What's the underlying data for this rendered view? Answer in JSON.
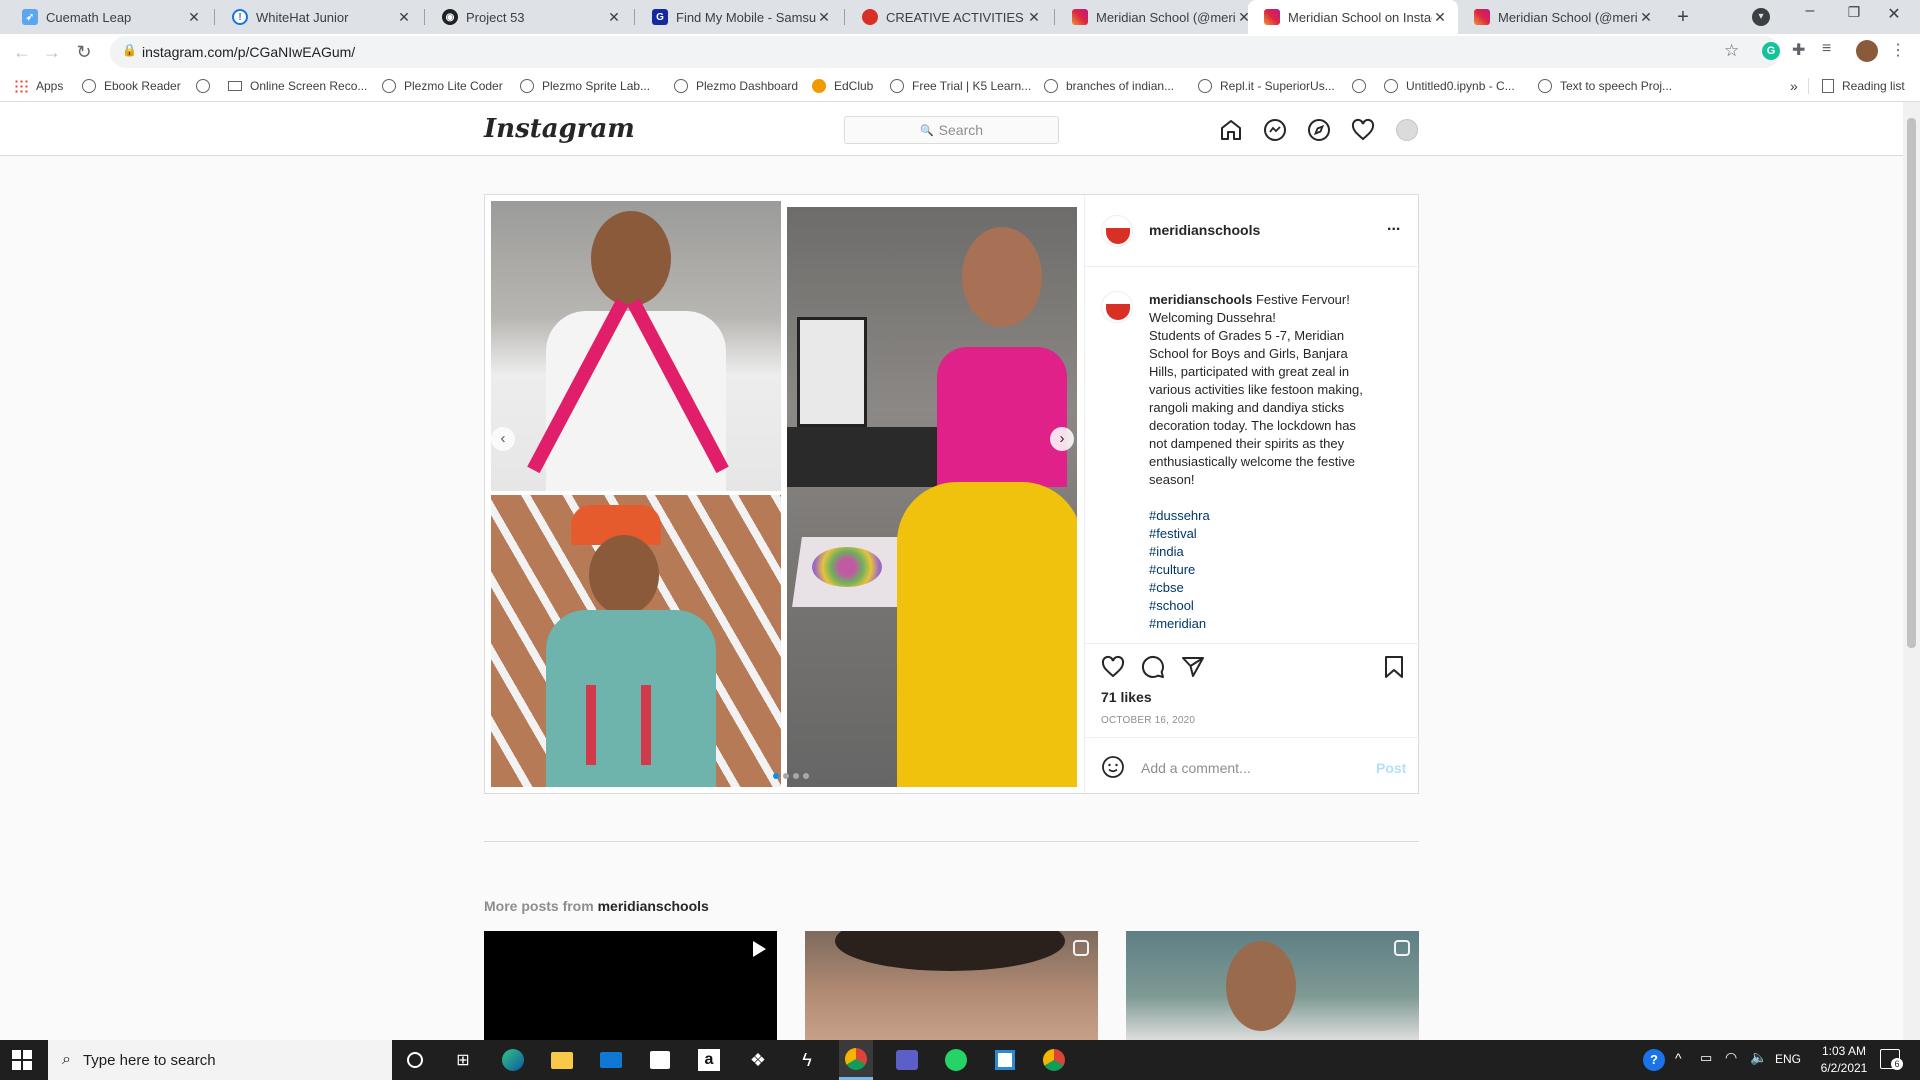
{
  "browser": {
    "tabs": [
      {
        "label": "Cuemath Leap",
        "icon": "rocket-icon",
        "color": "#2f80ed"
      },
      {
        "label": "WhiteHat Junior",
        "icon": "whitehat-icon",
        "color": "#1a73e8"
      },
      {
        "label": "Project 53",
        "icon": "project-icon",
        "color": "#202124"
      },
      {
        "label": "Find My Mobile - Samsung",
        "icon": "samsung-icon",
        "color": "#1428a0"
      },
      {
        "label": "CREATIVE ACTIVITIES - Me",
        "icon": "meridian-icon",
        "color": "#d93025"
      },
      {
        "label": "Meridian School (@meridi",
        "icon": "instagram-icon",
        "color": "#d6249f"
      },
      {
        "label": "Meridian School on Instag",
        "icon": "instagram-icon",
        "color": "#d6249f"
      },
      {
        "label": "Meridian School (@meridi",
        "icon": "instagram-icon",
        "color": "#d6249f"
      }
    ],
    "url": "instagram.com/p/CGaNIwEAGum/",
    "bookmarks": [
      "Apps",
      "Ebook Reader",
      "",
      "Online Screen Reco...",
      "Plezmo Lite Coder",
      "Plezmo Sprite Lab...",
      "Plezmo Dashboard",
      "EdClub",
      "Free Trial | K5 Learn...",
      "branches of indian...",
      "Repl.it - SuperiorUs...",
      "",
      "Untitled0.ipynb - C...",
      "Text to speech Proj..."
    ],
    "reading_list": "Reading list",
    "overflow": "»"
  },
  "instagram": {
    "logo": "Instagram",
    "search_placeholder": "Search",
    "post": {
      "username": "meridianschools",
      "caption_lead": "Festive Fervour!",
      "caption_lines": [
        "Welcoming Dussehra!",
        "Students of Grades 5 -7, Meridian",
        "School for Boys and Girls, Banjara",
        "Hills, participated with great zeal in",
        "various activities like festoon making,",
        "rangoli making and dandiya sticks",
        "decoration today. The lockdown has",
        "not dampened their spirits as they",
        "enthusiastically welcome the festive",
        "season!"
      ],
      "hashtags": [
        "#dussehra",
        "#festival",
        "#india",
        "#culture",
        "#cbse",
        "#school",
        "#meridian"
      ],
      "likes": "71 likes",
      "date": "OCTOBER 16, 2020",
      "comment_placeholder": "Add a comment...",
      "post_button": "Post",
      "more_options": "..."
    },
    "more_posts_prefix": "More posts from ",
    "more_posts_user": "meridianschools"
  },
  "taskbar": {
    "search_placeholder": "Type here to search",
    "language": "ENG",
    "time": "1:03 AM",
    "date": "6/2/2021",
    "notifications": "6"
  }
}
